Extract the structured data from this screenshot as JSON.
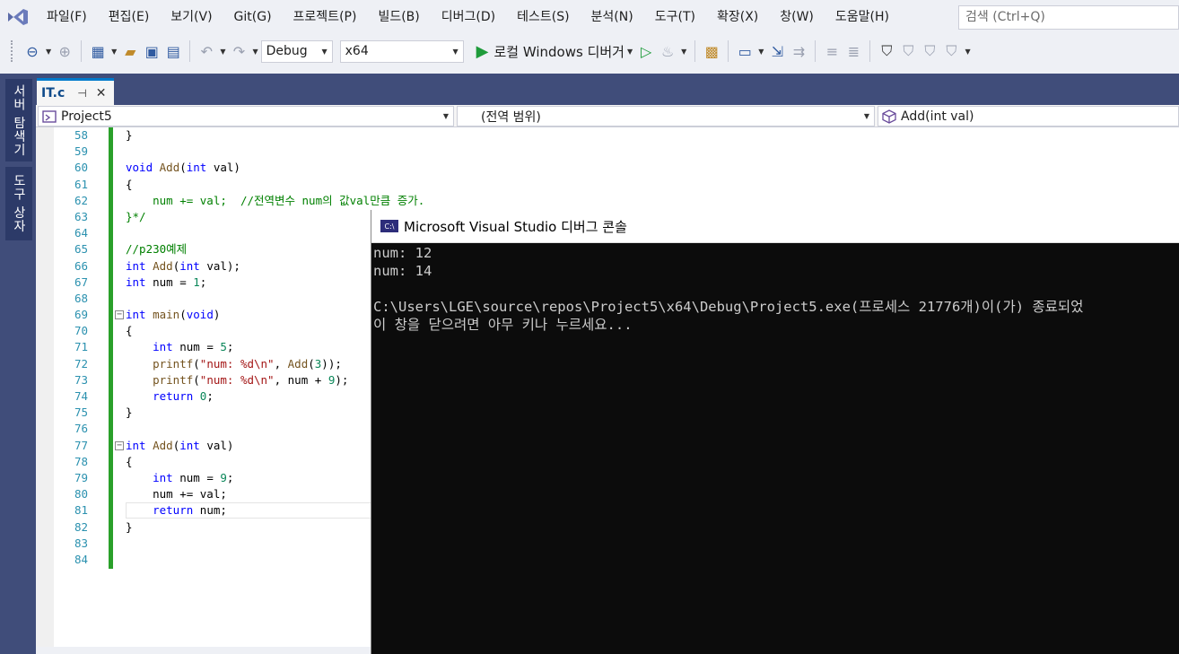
{
  "menu": {
    "items": [
      "파일(F)",
      "편집(E)",
      "보기(V)",
      "Git(G)",
      "프로젝트(P)",
      "빌드(B)",
      "디버그(D)",
      "테스트(S)",
      "분석(N)",
      "도구(T)",
      "확장(X)",
      "창(W)",
      "도움말(H)"
    ],
    "search_placeholder": "검색 (Ctrl+Q)"
  },
  "toolbar": {
    "config": "Debug",
    "platform": "x64",
    "run_label": "로컬 Windows 디버거"
  },
  "side_tabs": [
    "서버 탐색기",
    "도구 상자"
  ],
  "document": {
    "tab_name": "IT.c",
    "nav_project": "Project5",
    "nav_scope": "(전역 범위)",
    "nav_member": "Add(int val)"
  },
  "editor": {
    "line_numbers": [
      "58",
      "59",
      "60",
      "61",
      "62",
      "63",
      "64",
      "65",
      "66",
      "67",
      "68",
      "69",
      "70",
      "71",
      "72",
      "73",
      "74",
      "75",
      "76",
      "77",
      "78",
      "79",
      "80",
      "81",
      "82",
      "83",
      "84"
    ]
  },
  "console": {
    "title": "Microsoft Visual Studio 디버그 콘솔",
    "lines": [
      "num: 12",
      "num: 14",
      "",
      "C:\\Users\\LGE\\source\\repos\\Project5\\x64\\Debug\\Project5.exe(프로세스 21776개)이(가) 종료되었",
      "이 창을 닫으려면 아무 키나 누르세요..."
    ]
  },
  "colors": {
    "accent": "#007acc",
    "rail": "#404d7a",
    "change_bar": "#2aa02a",
    "console_bg": "#0c0c0c"
  }
}
